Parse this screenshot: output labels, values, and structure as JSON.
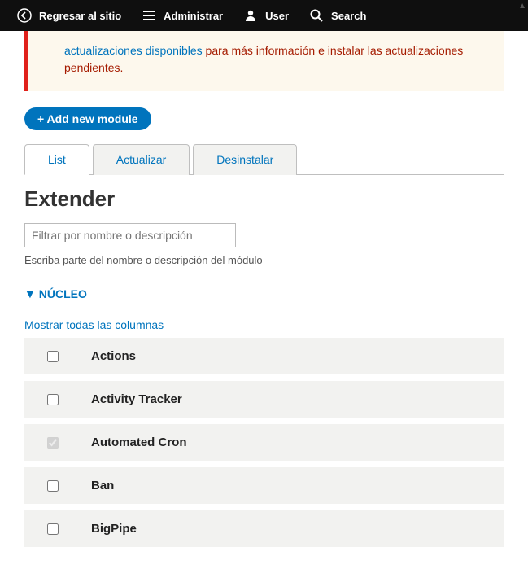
{
  "toolbar": {
    "back": "Regresar al sitio",
    "admin": "Administrar",
    "user": "User",
    "search": "Search"
  },
  "alert": {
    "link_text": "actualizaciones disponibles",
    "text_after": " para más información e instalar las actualizaciones pendientes."
  },
  "buttons": {
    "add_module": "+ Add new module"
  },
  "tabs": {
    "list": "List",
    "update": "Actualizar",
    "uninstall": "Desinstalar"
  },
  "page_title": "Extender",
  "filter": {
    "placeholder": "Filtrar por nombre o descripción",
    "help": "Escriba parte del nombre o descripción del módulo"
  },
  "section": {
    "nucleo": "▼ NÚCLEO",
    "show_all": "Mostrar todas las columnas"
  },
  "modules": [
    {
      "name": "Actions",
      "checked": false,
      "disabled": false
    },
    {
      "name": "Activity Tracker",
      "checked": false,
      "disabled": false
    },
    {
      "name": "Automated Cron",
      "checked": true,
      "disabled": true
    },
    {
      "name": "Ban",
      "checked": false,
      "disabled": false
    },
    {
      "name": "BigPipe",
      "checked": false,
      "disabled": false
    }
  ]
}
